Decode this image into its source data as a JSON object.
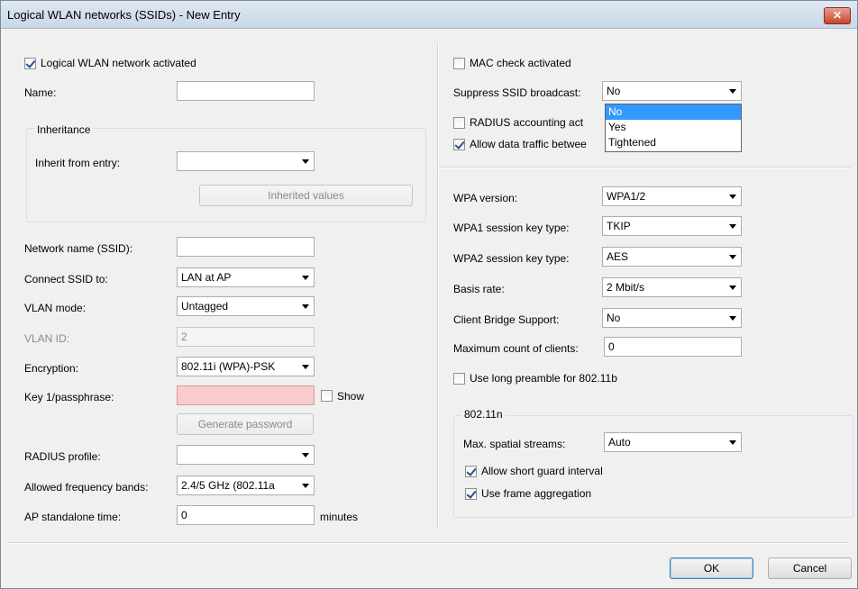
{
  "window": {
    "title": "Logical WLAN networks (SSIDs) - New Entry",
    "close_glyph": "✕"
  },
  "left": {
    "activated_label": "Logical WLAN network activated",
    "activated_checked": true,
    "name_label": "Name:",
    "name_value": "",
    "inheritance": {
      "caption": "Inheritance",
      "inherit_label": "Inherit from entry:",
      "inherit_value": "",
      "inherited_values_button": "Inherited values"
    },
    "ssid_label": "Network name (SSID):",
    "ssid_value": "",
    "connect_label": "Connect SSID to:",
    "connect_value": "LAN at AP",
    "vlan_mode_label": "VLAN mode:",
    "vlan_mode_value": "Untagged",
    "vlan_id_label": "VLAN ID:",
    "vlan_id_value": "2",
    "encryption_label": "Encryption:",
    "encryption_value": "802.11i (WPA)-PSK",
    "key_label": "Key 1/passphrase:",
    "key_value": "",
    "show_label": "Show",
    "generate_button": "Generate password",
    "radius_label": "RADIUS profile:",
    "radius_value": "",
    "bands_label": "Allowed frequency bands:",
    "bands_value": "2.4/5 GHz (802.11a",
    "standalone_label": "AP standalone time:",
    "standalone_value": "0",
    "standalone_unit": "minutes"
  },
  "right": {
    "mac_check_label": "MAC check activated",
    "suppress_label": "Suppress SSID broadcast:",
    "suppress_value": "No",
    "suppress_options": [
      "No",
      "Yes",
      "Tightened"
    ],
    "radius_accounting_label": "RADIUS accounting act",
    "allow_traffic_label": "Allow data traffic betwee",
    "wpa_version_label": "WPA version:",
    "wpa_version_value": "WPA1/2",
    "wpa1_key_label": "WPA1 session key type:",
    "wpa1_key_value": "TKIP",
    "wpa2_key_label": "WPA2 session key type:",
    "wpa2_key_value": "AES",
    "basis_rate_label": "Basis rate:",
    "basis_rate_value": "2 Mbit/s",
    "client_bridge_label": "Client Bridge Support:",
    "client_bridge_value": "No",
    "max_clients_label": "Maximum count of clients:",
    "max_clients_value": "0",
    "long_preamble_label": "Use long preamble for 802.11b",
    "n_group": {
      "caption": "802.11n",
      "spatial_label": "Max. spatial streams:",
      "spatial_value": "Auto",
      "short_guard_label": "Allow short guard interval",
      "frame_agg_label": "Use frame aggregation"
    }
  },
  "footer": {
    "ok_label": "OK",
    "cancel_label": "Cancel"
  }
}
